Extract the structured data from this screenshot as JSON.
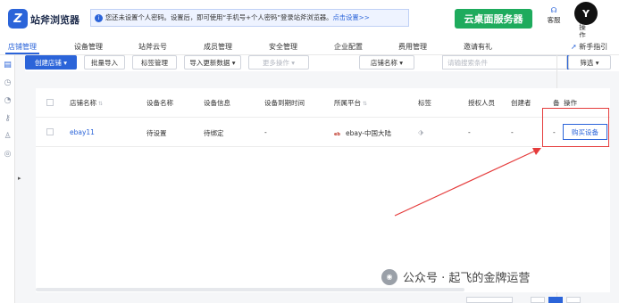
{
  "header": {
    "logo_text": "站斧浏览器",
    "notice_text": "您还未设置个人密码。设置后，即可使用“手机号+个人密码”登录站斧浏览器。",
    "notice_link": "点击设置>>",
    "cloud_button": "云桌面服务器",
    "service_label": "客服",
    "avatar_label": "操作"
  },
  "nav": {
    "items": [
      "店铺管理",
      "设备管理",
      "站斧云号",
      "成员管理",
      "安全管理",
      "企业配置",
      "费用管理",
      "邀请有礼"
    ],
    "guide_label": "新手指引"
  },
  "toolbar": {
    "create_shop": "创建店铺 ▾",
    "batch_import": "批量导入",
    "tag_manage": "标签管理",
    "import_update": "导入更新数据 ▾",
    "more_ops": "更多操作 ▾",
    "search_field": "店铺名称 ▾",
    "search_placeholder": "请输搜索条件",
    "filter": "筛选 ▾"
  },
  "table": {
    "headers": [
      "店铺名称",
      "设备名称",
      "设备信息",
      "设备到期时间",
      "所属平台",
      "标签",
      "授权人员",
      "创建者",
      "备",
      "操作"
    ],
    "rows": [
      {
        "shop_name": "ebay11",
        "device_name": "待设置",
        "device_info": "待绑定",
        "expire": "-",
        "platform": "ebay-中国大陆",
        "auth": "-",
        "creator": "-",
        "note": "-",
        "action": "购买设备"
      }
    ]
  },
  "watermark": "公众号 · 起飞的金牌运营"
}
